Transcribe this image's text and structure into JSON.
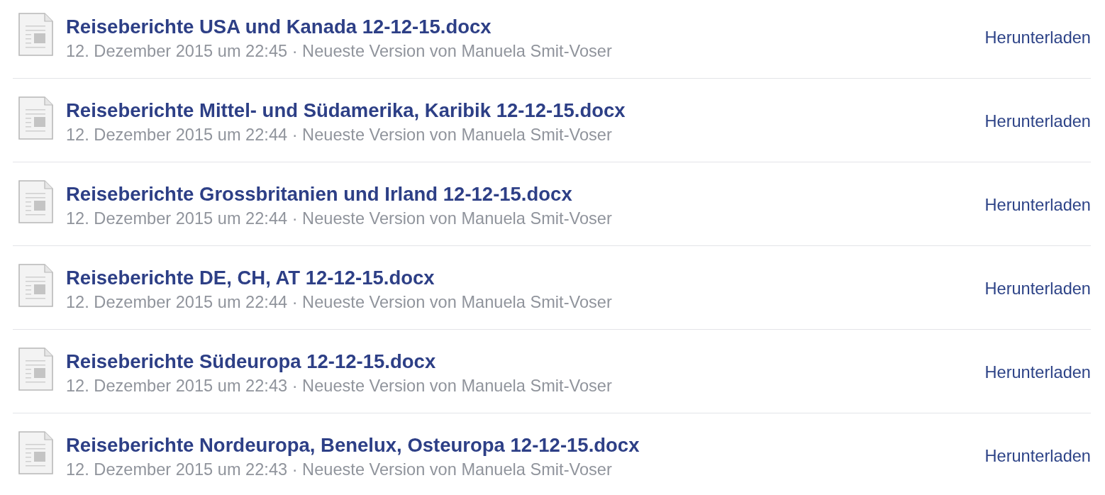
{
  "files": [
    {
      "name": "Reiseberichte USA und Kanada 12-12-15.docx",
      "meta": "12. Dezember 2015 um 22:45 · Neueste Version von Manuela Smit-Voser",
      "action": "Herunterladen"
    },
    {
      "name": "Reiseberichte Mittel- und Südamerika, Karibik 12-12-15.docx",
      "meta": "12. Dezember 2015 um 22:44 · Neueste Version von Manuela Smit-Voser",
      "action": "Herunterladen"
    },
    {
      "name": "Reiseberichte Grossbritanien und Irland 12-12-15.docx",
      "meta": "12. Dezember 2015 um 22:44 · Neueste Version von Manuela Smit-Voser",
      "action": "Herunterladen"
    },
    {
      "name": "Reiseberichte DE, CH, AT 12-12-15.docx",
      "meta": "12. Dezember 2015 um 22:44 · Neueste Version von Manuela Smit-Voser",
      "action": "Herunterladen"
    },
    {
      "name": "Reiseberichte Südeuropa 12-12-15.docx",
      "meta": "12. Dezember 2015 um 22:43 · Neueste Version von Manuela Smit-Voser",
      "action": "Herunterladen"
    },
    {
      "name": "Reiseberichte Nordeuropa, Benelux, Osteuropa 12-12-15.docx",
      "meta": "12. Dezember 2015 um 22:43 · Neueste Version von Manuela Smit-Voser",
      "action": "Herunterladen"
    }
  ]
}
